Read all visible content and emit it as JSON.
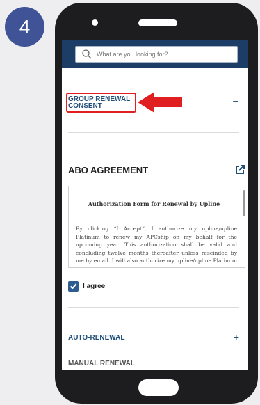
{
  "step": {
    "number": "4"
  },
  "search": {
    "placeholder": "What are you looking for?"
  },
  "sections": {
    "group_renewal": {
      "line1": "GROUP RENEWAL",
      "line2": "CONSENT",
      "toggle": "–"
    },
    "abo_agreement": {
      "title": "ABO AGREEMENT"
    },
    "auto_renewal": {
      "label": "AUTO-RENEWAL",
      "toggle": "+"
    },
    "manual_renewal": {
      "label": "MANUAL RENEWAL"
    }
  },
  "document": {
    "title": "Authorization Form for Renewal by Upline",
    "body": "By clicking “I Accept”, I authorize my upline/upline Platinum to renew my APCship on my behalf for the upcoming year. This authorization shall be valid and concluding twelve months thereafter unless rescinded by me by email. I will also authorize my upline/upline Platinum to receive any notices."
  },
  "agree": {
    "label": "I agree",
    "checked": true
  },
  "colors": {
    "accent": "#1f4e79",
    "header": "#1b3d66",
    "badge": "#3f5396",
    "highlight": "#e02020"
  },
  "icons": [
    "search-icon",
    "external-link-icon",
    "check-icon",
    "arrow-left-icon"
  ]
}
